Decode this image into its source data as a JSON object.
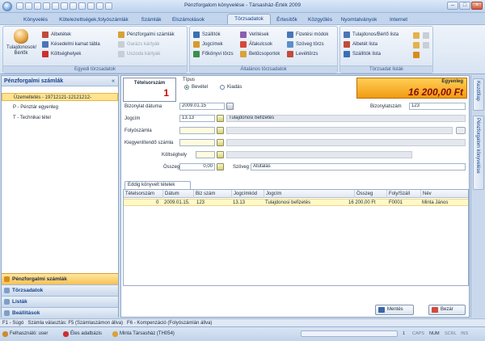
{
  "window": {
    "title": "Pénzforgalom könyvelése - Társasház-Érték 2009"
  },
  "tabs": [
    {
      "label": "Könyvelés"
    },
    {
      "label": "Kötelezettségek,folyószámlák"
    },
    {
      "label": "Számlák"
    },
    {
      "label": "Elszámolások"
    },
    {
      "label": "Törzsadatok"
    },
    {
      "label": "Értesítők"
    },
    {
      "label": "Közgyűlés"
    },
    {
      "label": "Nyomtatványok"
    },
    {
      "label": "Internet"
    }
  ],
  "ribbon": {
    "groups": [
      {
        "label": "Egyedi törzsadatok"
      },
      {
        "label": "Általános törzsadatok"
      },
      {
        "label": "Törzsadat listák"
      }
    ],
    "tulajdonos": "Tulajdonosok/\nBérlők",
    "items": [
      {
        "label": "Albetétek"
      },
      {
        "label": "Késedelmi kamat tábla"
      },
      {
        "label": "Költséghelyek"
      },
      {
        "label": "Pénzforgalmi számlák"
      },
      {
        "label": "Garázs kártyák"
      },
      {
        "label": "Uszoda kártyák"
      },
      {
        "label": "Szállítók"
      },
      {
        "label": "Jogcímek"
      },
      {
        "label": "Főkönyvi törzs"
      },
      {
        "label": "Vetítések"
      },
      {
        "label": "Áfakulcsok"
      },
      {
        "label": "Betűcsoportok"
      },
      {
        "label": "Fizetési módok"
      },
      {
        "label": "Szöveg törzs"
      },
      {
        "label": "Levéltörzs"
      },
      {
        "label": "Tulajdonos/Bérlő lista"
      },
      {
        "label": "Albetét lista"
      },
      {
        "label": "Szállítók lista"
      }
    ]
  },
  "left": {
    "title": "Pénzforgalmi számlák",
    "collapse": "«",
    "accounts": [
      {
        "label": "Üzemeltetés - 19712121-12121212-"
      },
      {
        "label": "P - Pénztár egyenleg"
      },
      {
        "label": "T - Technikai tétel"
      }
    ],
    "nav": [
      {
        "label": "Pénzforgalmi számlák"
      },
      {
        "label": "Törzsadatok"
      },
      {
        "label": "Listák"
      },
      {
        "label": "Beállítások"
      }
    ]
  },
  "form": {
    "serial_label": "Tételsorszám",
    "serial_value": "1",
    "type_label": "Típus",
    "type_in": "Bevétel",
    "type_out": "Kiadás",
    "balance_label": "Egyenleg",
    "balance_value": "16 200,00 Ft",
    "date_label": "Bizonylat dátuma",
    "date_value": "2009.01.15",
    "docnum_label": "Bizonylatszám",
    "docnum_value": "123",
    "jogcim_label": "Jogcím",
    "jogcim_code": "13.13",
    "jogcim_text": "Tulajdonosi befizetés",
    "folyo_label": "Folyószámla",
    "kieg_label": "Kiegyenlítendő számla",
    "kolts_label": "Költséghely",
    "osszeg_label": "Összeg",
    "osszeg_value": "0,00",
    "szoveg_label": "Szöveg",
    "szoveg_value": "Átutalás"
  },
  "grid": {
    "tab_label": "Eddig könyvelt tételek",
    "columns": [
      "Tételsorszám",
      "Dátum",
      "Biz szám",
      "Jogcímkód",
      "Jogcím",
      "Összeg",
      "Foly/Száll",
      "Név"
    ],
    "rows": [
      [
        "0",
        "2009.01.15.",
        "123",
        "13.13",
        "Tulajdonosi befizetés",
        "16 200,00 Ft",
        "F0001",
        "Minta János"
      ]
    ]
  },
  "buttons": {
    "save": "Mentés",
    "close": "Bezár"
  },
  "side_tabs": [
    {
      "label": "Kezdőlap"
    },
    {
      "label": "Pénzforgalom könyvelése"
    }
  ],
  "hint": "F1 - Súgó   Számla választás: F5 (Számlaszámon állva)   F6 - Kompenzáció (Folyószámlán állva)",
  "status": {
    "user": "Felhasználó: user",
    "db": "Éles adatbázis",
    "company": "Minta Társasház (TH054)",
    "page": "1",
    "keys": [
      "CAPS",
      "NUM",
      "SCRL",
      "INS"
    ]
  }
}
